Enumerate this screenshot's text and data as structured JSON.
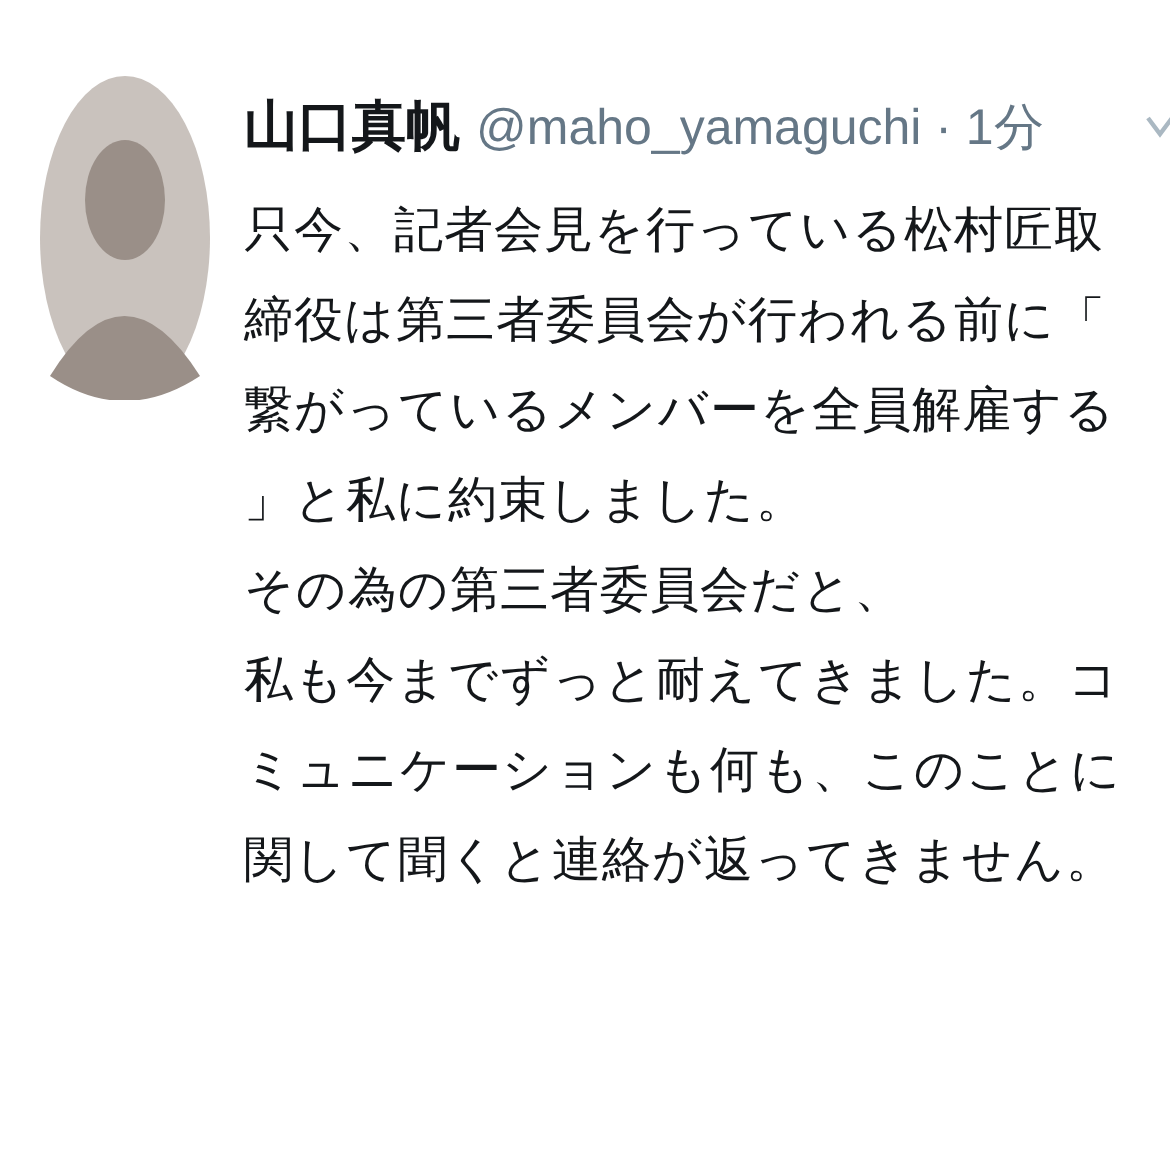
{
  "tweet": {
    "author_name": "山口真帆",
    "handle": "@maho_yamaguchi",
    "separator": "·",
    "time": "1分",
    "paragraphs": [
      "只今、記者会見を行っている松村匠取締役は第三者委員会が行われる前に「繋がっているメンバーを全員解雇する」と私に約束しました。",
      "その為の第三者委員会だと、",
      "私も今までずっと耐えてきました。コミュニケーションも何も、このことに関して聞くと連絡が返ってきません。"
    ]
  }
}
